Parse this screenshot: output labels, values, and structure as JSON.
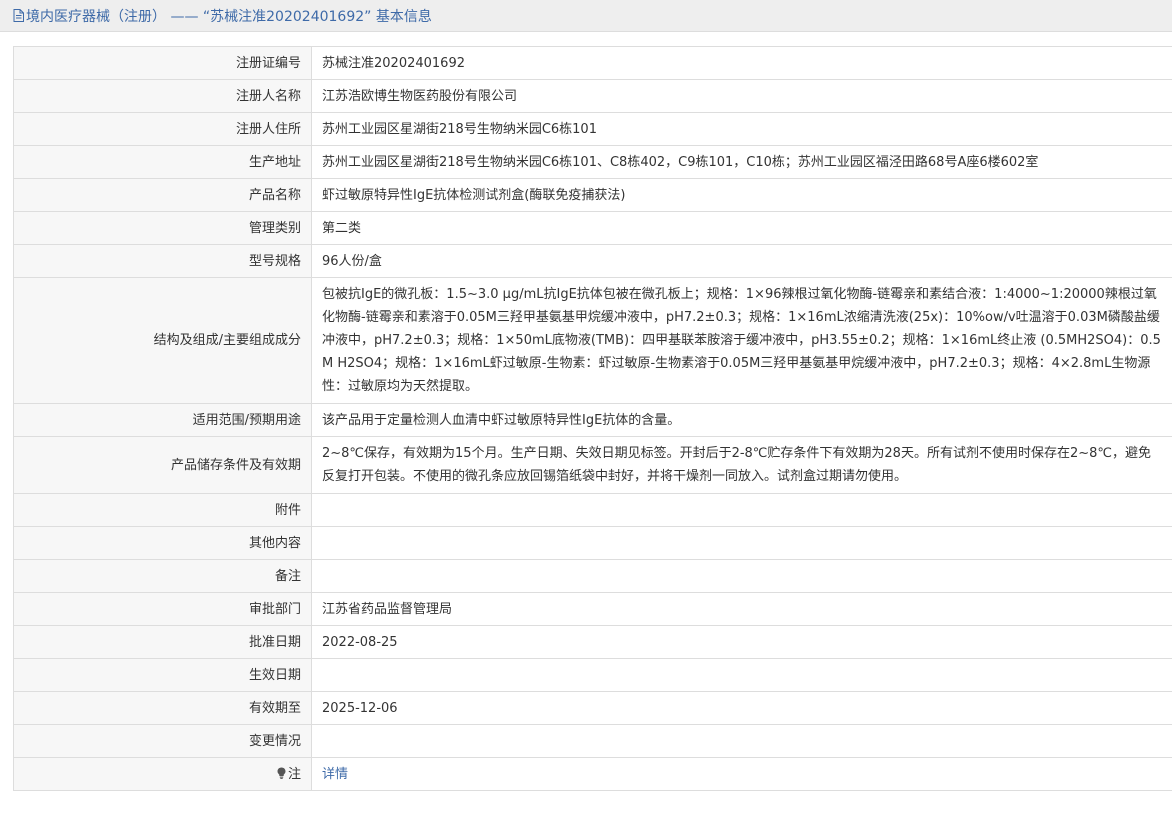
{
  "header": {
    "title": "境内医疗器械（注册） —— “苏械注准20202401692” 基本信息"
  },
  "rows": [
    {
      "label": "注册证编号",
      "value": "苏械注准20202401692"
    },
    {
      "label": "注册人名称",
      "value": "江苏浩欧博生物医药股份有限公司"
    },
    {
      "label": "注册人住所",
      "value": "苏州工业园区星湖街218号生物纳米园C6栋101"
    },
    {
      "label": "生产地址",
      "value": "苏州工业园区星湖街218号生物纳米园C6栋101、C8栋402，C9栋101，C10栋；苏州工业园区福泾田路68号A座6楼602室"
    },
    {
      "label": "产品名称",
      "value": "虾过敏原特异性IgE抗体检测试剂盒(酶联免疫捕获法)"
    },
    {
      "label": "管理类别",
      "value": "第二类"
    },
    {
      "label": "型号规格",
      "value": "96人份/盒"
    },
    {
      "label": "结构及组成/主要组成成分",
      "value": "包被抗IgE的微孔板：1.5~3.0 μg/mL抗IgE抗体包被在微孔板上；规格：1×96辣根过氧化物酶-链霉亲和素结合液：1:4000~1:20000辣根过氧化物酶-链霉亲和素溶于0.05M三羟甲基氨基甲烷缓冲液中，pH7.2±0.3；规格：1×16mL浓缩清洗液(25x)：10%ow/v吐温溶于0.03M磷酸盐缓冲液中，pH7.2±0.3；规格：1×50mL底物液(TMB)：四甲基联苯胺溶于缓冲液中，pH3.55±0.2；规格：1×16mL终止液 (0.5MH2SO4)：0.5M H2SO4；规格：1×16mL虾过敏原-生物素：虾过敏原-生物素溶于0.05M三羟甲基氨基甲烷缓冲液中，pH7.2±0.3；规格：4×2.8mL生物源性：过敏原均为天然提取。"
    },
    {
      "label": "适用范围/预期用途",
      "value": "该产品用于定量检测人血清中虾过敏原特异性IgE抗体的含量。"
    },
    {
      "label": "产品储存条件及有效期",
      "value": "2~8℃保存，有效期为15个月。生产日期、失效日期见标签。开封后于2-8℃贮存条件下有效期为28天。所有试剂不使用时保存在2~8℃，避免反复打开包装。不使用的微孔条应放回锡箔纸袋中封好，并将干燥剂一同放入。试剂盒过期请勿使用。"
    },
    {
      "label": "附件",
      "value": ""
    },
    {
      "label": "其他内容",
      "value": ""
    },
    {
      "label": "备注",
      "value": ""
    },
    {
      "label": "审批部门",
      "value": "江苏省药品监督管理局"
    },
    {
      "label": "批准日期",
      "value": "2022-08-25"
    },
    {
      "label": "生效日期",
      "value": ""
    },
    {
      "label": "有效期至",
      "value": "2025-12-06"
    },
    {
      "label": "变更情况",
      "value": ""
    }
  ],
  "note_row": {
    "label": "注",
    "link_text": "详情",
    "icon": "lightbulb-icon"
  },
  "colors": {
    "link": "#3e6aa8",
    "label_bg": "#f7f7f7",
    "border": "#dddddd",
    "header_bg": "#eeeeee"
  }
}
